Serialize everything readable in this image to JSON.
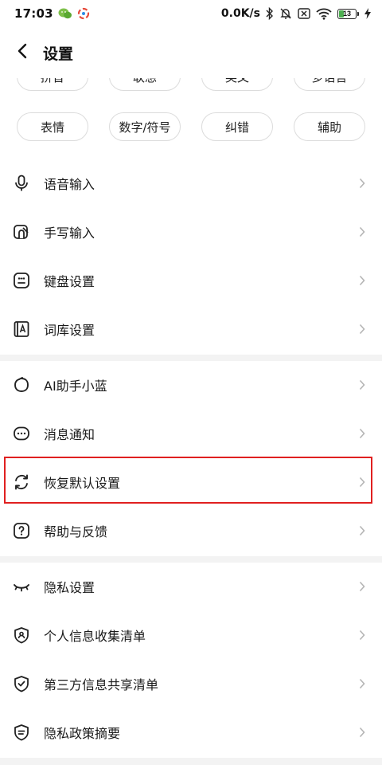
{
  "status_bar": {
    "time": "17:03",
    "network_speed": "0.0K/s",
    "battery_level": "13"
  },
  "header": {
    "title": "设置"
  },
  "chips": {
    "row_top": [
      "拼音",
      "联想",
      "英文",
      "多语言"
    ],
    "row_second": [
      "表情",
      "数字/符号",
      "纠错",
      "辅助"
    ]
  },
  "menu": {
    "voice_input": "语音输入",
    "handwriting_input": "手写输入",
    "keyboard_settings": "键盘设置",
    "lexicon_settings": "词库设置",
    "ai_assistant": "AI助手小蓝",
    "notifications": "消息通知",
    "restore_defaults": "恢复默认设置",
    "help_feedback": "帮助与反馈",
    "privacy_settings": "隐私设置",
    "personal_info_list": "个人信息收集清单",
    "third_party_list": "第三方信息共享清单",
    "privacy_policy_summary": "隐私政策摘要"
  },
  "colors": {
    "highlight": "#e02020",
    "section_gap": "#f3f3f3",
    "chevron": "#b5b5b5"
  }
}
